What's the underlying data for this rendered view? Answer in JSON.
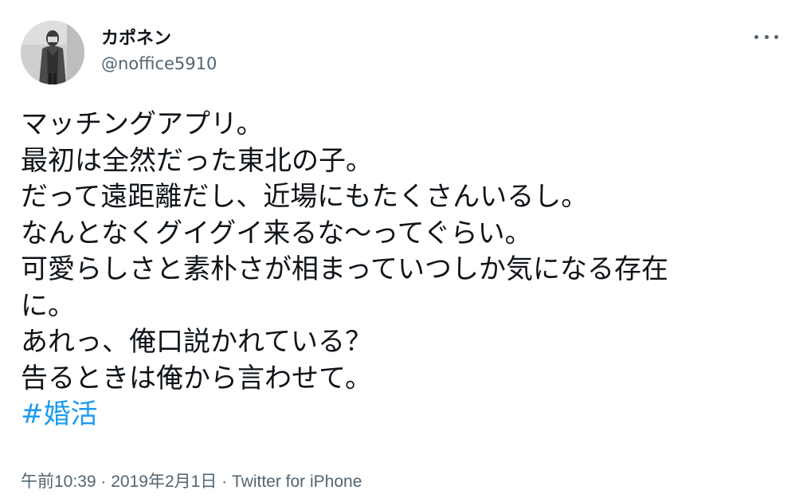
{
  "author": {
    "display_name": "カポネン",
    "handle": "@noffice5910",
    "avatar_icon": "profile-photo"
  },
  "menu": {
    "icon": "more-horizontal-icon"
  },
  "tweet": {
    "lines": [
      "マッチングアプリ。",
      "最初は全然だった東北の子。",
      "だって遠距離だし、近場にもたくさんいるし。",
      "なんとなくグイグイ来るな〜ってぐらい。",
      "可愛らしさと素朴さが相まっていつしか気になる存在",
      "に。",
      "あれっ、俺口説かれている？",
      "告るときは俺から言わせて。"
    ],
    "hashtag": "#婚活"
  },
  "meta": {
    "time": "午前10:39",
    "separator1": " · ",
    "date": "2019年2月1日",
    "separator2": " · ",
    "source": "Twitter for iPhone"
  },
  "colors": {
    "text": "#0f1419",
    "secondary": "#536471",
    "link": "#1d9bf0"
  }
}
